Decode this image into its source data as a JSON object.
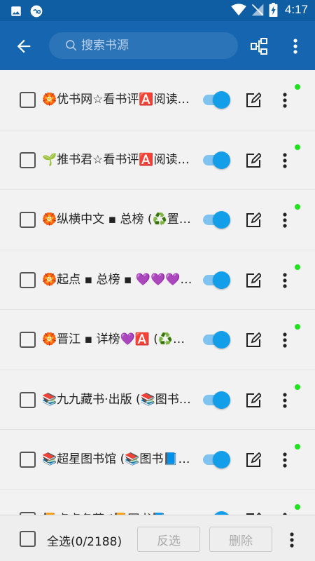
{
  "status_bar": {
    "time": "4:17"
  },
  "toolbar": {
    "search_placeholder": "搜索书源"
  },
  "sources": [
    {
      "name": "🏵️优书网☆看书评🅰️阅读…",
      "enabled": true
    },
    {
      "name": "🌱推书君☆看书评🅰️阅读…",
      "enabled": true
    },
    {
      "name": "🏵️纵横中文 ▪ 总榜 (♻️置…",
      "enabled": true
    },
    {
      "name": "🏵️起点 ▪ 总榜 ▪ 💜💜💜…",
      "enabled": true
    },
    {
      "name": "🏵️晋江 ▪ 详榜💜🅰️ (♻️置…",
      "enabled": true
    },
    {
      "name": "📚九九藏书·出版 (📚图书…",
      "enabled": true
    },
    {
      "name": "📚超星图书馆 (📚图书📘…",
      "enabled": true
    },
    {
      "name": "📙点点名著 (📙图书📘…",
      "enabled": true
    }
  ],
  "bottom_bar": {
    "select_all_label": "全选(0/2188)",
    "invert_label": "反选",
    "delete_label": "删除"
  },
  "colors": {
    "toolbar": "#1565b0",
    "status_bar": "#0f5ea3",
    "toggle_on": "#129ee8",
    "online_dot": "#1ee31e"
  },
  "icons": {
    "back": "arrow-left-icon",
    "search": "search-icon",
    "group": "group-icon",
    "more": "more-vert-icon",
    "edit": "edit-icon"
  }
}
